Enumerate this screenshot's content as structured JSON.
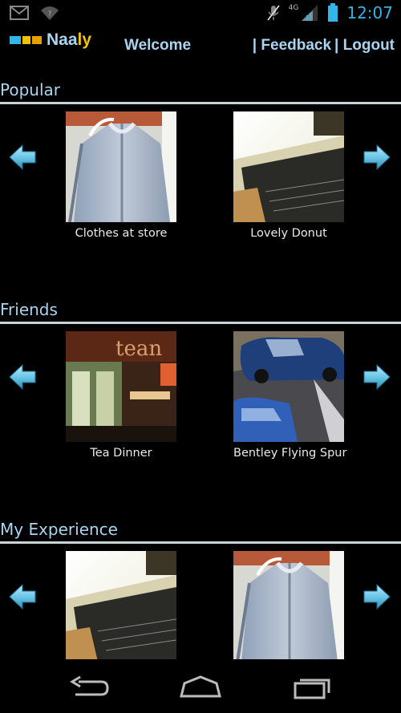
{
  "status_bar": {
    "time": "12:07",
    "network": "4G",
    "icons": [
      "gmail-icon",
      "wifi-icon",
      "mute-icon",
      "signal-icon",
      "battery-icon"
    ],
    "accent": "#33b5e5"
  },
  "header": {
    "brand_part1": "Naa",
    "brand_part2": "ly",
    "brand_colors": [
      "#a8d4ef",
      "#f2c200"
    ],
    "welcome": "Welcome",
    "feedback": "| Feedback",
    "logout": "| Logout"
  },
  "sections": [
    {
      "title": "Popular",
      "items": [
        {
          "caption": "Clothes at store",
          "image": "clothes"
        },
        {
          "caption": "Lovely Donut",
          "image": "laptop"
        }
      ]
    },
    {
      "title": "Friends",
      "items": [
        {
          "caption": "Tea Dinner",
          "image": "restaurant"
        },
        {
          "caption": "Bentley Flying Spur",
          "image": "cars"
        }
      ]
    },
    {
      "title": "My Experience",
      "items": [
        {
          "caption": "",
          "image": "laptop"
        },
        {
          "caption": "",
          "image": "clothes"
        }
      ]
    }
  ],
  "nav_bar": {
    "icons": [
      "back-icon",
      "home-icon",
      "recent-apps-icon"
    ]
  }
}
